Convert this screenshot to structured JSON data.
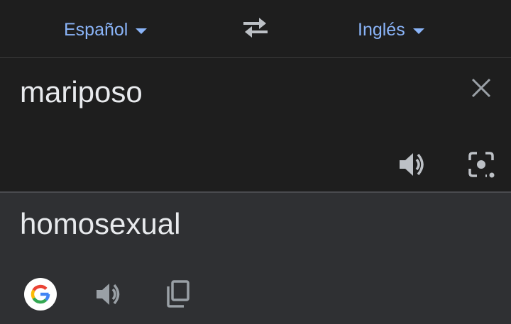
{
  "language_bar": {
    "source_language": "Español",
    "target_language": "Inglés",
    "swap_icon": "swap-arrows-icon",
    "dropdown_icon": "caret-down-icon"
  },
  "input": {
    "text": "mariposo",
    "clear_icon": "close-icon",
    "speak_icon": "speaker-icon",
    "camera_icon": "camera-icon"
  },
  "output": {
    "text": "homosexual",
    "google_icon": "google-icon",
    "speak_icon": "speaker-icon",
    "copy_icon": "copy-icon"
  },
  "colors": {
    "background": "#1e1e1e",
    "output_background": "#2f3033",
    "accent": "#8ab4f8",
    "text": "#e8eaed",
    "icon": "#bdc1c6",
    "icon_muted": "#9aa0a6"
  }
}
